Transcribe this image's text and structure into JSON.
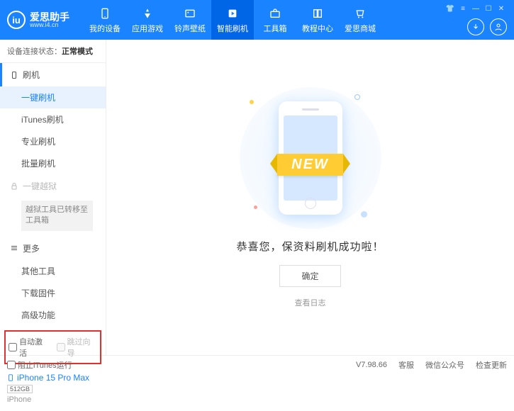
{
  "app": {
    "name": "爱思助手",
    "url": "www.i4.cn",
    "logo_letter": "iu"
  },
  "nav": [
    {
      "label": "我的设备"
    },
    {
      "label": "应用游戏"
    },
    {
      "label": "铃声壁纸"
    },
    {
      "label": "智能刷机"
    },
    {
      "label": "工具箱"
    },
    {
      "label": "教程中心"
    },
    {
      "label": "爱思商城"
    }
  ],
  "connection": {
    "prefix": "设备连接状态：",
    "status": "正常模式"
  },
  "sidebar": {
    "sec_flash": "刷机",
    "items_flash": [
      "一键刷机",
      "iTunes刷机",
      "专业刷机",
      "批量刷机"
    ],
    "sec_jail": "一键越狱",
    "jail_note": "越狱工具已转移至工具箱",
    "sec_more": "更多",
    "items_more": [
      "其他工具",
      "下载固件",
      "高级功能"
    ]
  },
  "options": {
    "auto_activate": "自动激活",
    "skip_guide": "跳过向导"
  },
  "device": {
    "name": "iPhone 15 Pro Max",
    "capacity": "512GB",
    "type": "iPhone"
  },
  "main": {
    "ribbon": "NEW",
    "message": "恭喜您，保资料刷机成功啦！",
    "ok": "确定",
    "view_log": "查看日志"
  },
  "status": {
    "block_itunes": "阻止iTunes运行",
    "version": "V7.98.66",
    "links": [
      "客服",
      "微信公众号",
      "检查更新"
    ]
  }
}
